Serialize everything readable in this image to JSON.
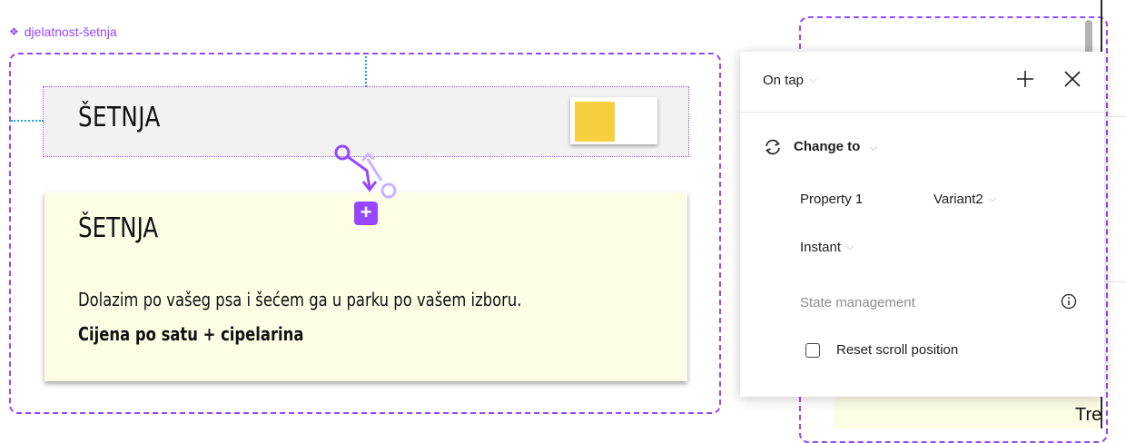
{
  "component": {
    "name": "djelatnost-šetnja",
    "variant1_title": "ŠETNJA",
    "variant2_title": "ŠETNJA",
    "variant2_description": "Dolazim po vašeg psa i šećem ga u parku po vašem izboru.",
    "variant2_price": "Cijena po satu + cipelarina"
  },
  "right_frame": {
    "partial_text": "Tre"
  },
  "interaction_panel": {
    "trigger": "On tap",
    "action": "Change to",
    "property_label": "Property 1",
    "property_value": "Variant2",
    "animation": "Instant",
    "state_management_label": "State management",
    "reset_scroll_label": "Reset scroll position",
    "reset_scroll_checked": false
  },
  "icons": {
    "add": "plus-icon",
    "close": "close-icon",
    "action": "swap-icon",
    "info": "info-icon",
    "component": "component-diamond-icon",
    "connector": "prototype-connector-icon"
  },
  "colors": {
    "accent": "#9747ff",
    "guide": "#18a0fb",
    "toggle_knob": "#f5cf3e",
    "card_bg": "#fdfde6",
    "bar_bg": "#f3f2f2"
  }
}
